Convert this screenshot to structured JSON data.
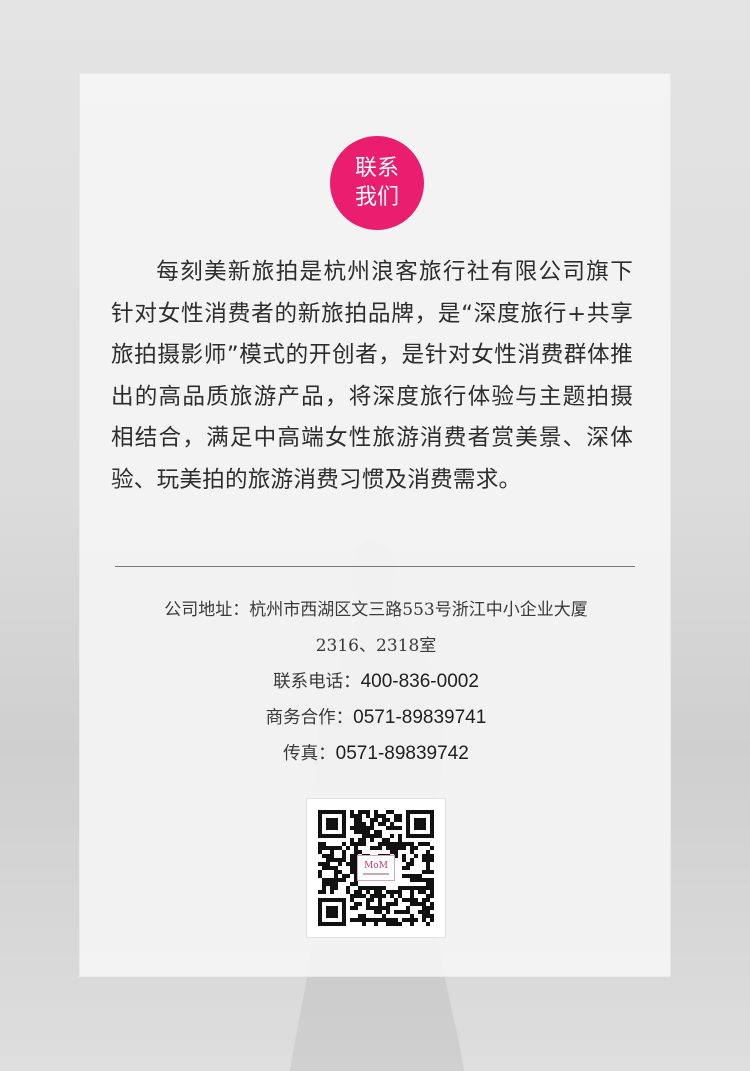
{
  "badge": {
    "line1": "联系",
    "line2": "我们",
    "color": "#ea1d6e"
  },
  "intro": "每刻美新旅拍是杭州浪客旅行社有限公司旗下针对女性消费者的新旅拍品牌，是“深度旅行+共享旅拍摄影师”模式的开创者，是针对女性消费群体推出的高品质旅游产品，将深度旅行体验与主题拍摄相结合，满足中高端女性旅游消费者赏美景、深体验、玩美拍的旅游消费习惯及消费需求。",
  "contact": {
    "address_label": "公司地址：",
    "address_line1": "杭州市西湖区文三路553号浙江中小企业大厦",
    "address_line2": "2316、2318室",
    "phone_label": "联系电话：",
    "phone": "400-836-0002",
    "business_label": "商务合作：",
    "business": "0571-89839741",
    "fax_label": "传真：",
    "fax": "0571-89839742"
  },
  "qr": {
    "icon": "qr-code-icon",
    "logo_text": "MoM"
  }
}
